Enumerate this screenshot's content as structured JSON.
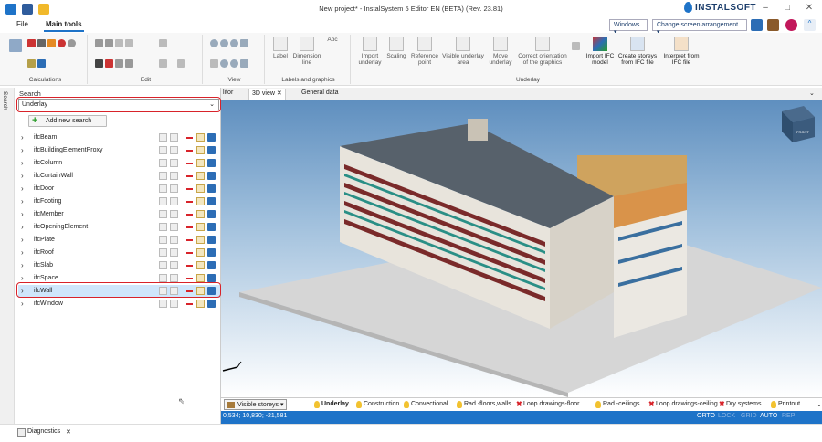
{
  "window": {
    "title": "New project* - InstalSystem 5 Editor EN (BETA) (Rev. 23.81)",
    "brand": "INSTALSOFT",
    "controls": [
      "–",
      "□",
      "✕"
    ]
  },
  "menu": {
    "tabs": [
      "File",
      "Main tools"
    ],
    "active_tab": "Main tools",
    "windows_combo": "Windows",
    "arrangement_combo": "Change screen arrangement"
  },
  "ribbon": {
    "groups": [
      "Calculations",
      "Edit",
      "View",
      "Labels and graphics",
      "Underlay"
    ],
    "buttons": {
      "label": "Label",
      "dimension_line": "Dimension line",
      "abc": "Abc",
      "import_underlay": "Import underlay",
      "scaling": "Scaling",
      "reference_point": "Reference point",
      "visible_underlay_area": "Visible underlay area",
      "move_underlay": "Move underlay",
      "correct_orientation": "Correct orientation of the graphics",
      "import_ifc": "Import IFC model",
      "create_storeys": "Create storeys from IFC file",
      "interpret": "Interpret from IFC file"
    }
  },
  "left_panel": {
    "strip_label": "Search",
    "title": "Search",
    "select_value": "Underlay",
    "add_button": "Add new search",
    "items": [
      {
        "label": "ifcBeam"
      },
      {
        "label": "ifcBuildingElementProxy"
      },
      {
        "label": "ifcColumn"
      },
      {
        "label": "ifcCurtainWall"
      },
      {
        "label": "ifcDoor"
      },
      {
        "label": "ifcFooting"
      },
      {
        "label": "ifcMember"
      },
      {
        "label": "ifcOpeningElement"
      },
      {
        "label": "ifcPlate"
      },
      {
        "label": "ifcRoof"
      },
      {
        "label": "ifcSlab"
      },
      {
        "label": "ifcSpace"
      },
      {
        "label": "ifcWall"
      },
      {
        "label": "ifcWindow"
      }
    ],
    "selected_item": "ifcWall"
  },
  "diagnostics": {
    "label": "Diagnostics"
  },
  "doc_tabs": [
    "litor",
    "3D view",
    "General data"
  ],
  "viewcube_label": "FRONT",
  "layers": {
    "storeys_button": "Visible storeys",
    "items": [
      {
        "label": "Underlay",
        "marker": "bulb",
        "bold": true
      },
      {
        "label": "Construction",
        "marker": "bulb"
      },
      {
        "label": "Convectional",
        "marker": "bulb"
      },
      {
        "label": "Rad.-floors,walls",
        "marker": "bulb"
      },
      {
        "label": "Loop drawings-floor",
        "marker": "x"
      },
      {
        "label": "Rad.-ceilings",
        "marker": "bulb"
      },
      {
        "label": "Loop drawings-ceiling",
        "marker": "x"
      },
      {
        "label": "Dry systems",
        "marker": "x"
      },
      {
        "label": "Printout",
        "marker": "bulb"
      }
    ]
  },
  "status": {
    "coordinates": "0,534; 10,830; -21,581",
    "modes": [
      {
        "label": "ORTO",
        "on": true
      },
      {
        "label": "LOCK",
        "on": false
      },
      {
        "label": "GRID",
        "on": false
      },
      {
        "label": "AUTO",
        "on": true
      },
      {
        "label": "REP",
        "on": false
      }
    ]
  },
  "colors": {
    "accent": "#1e73c8",
    "highlight": "#d8232a",
    "selection": "#cfe6fb"
  }
}
